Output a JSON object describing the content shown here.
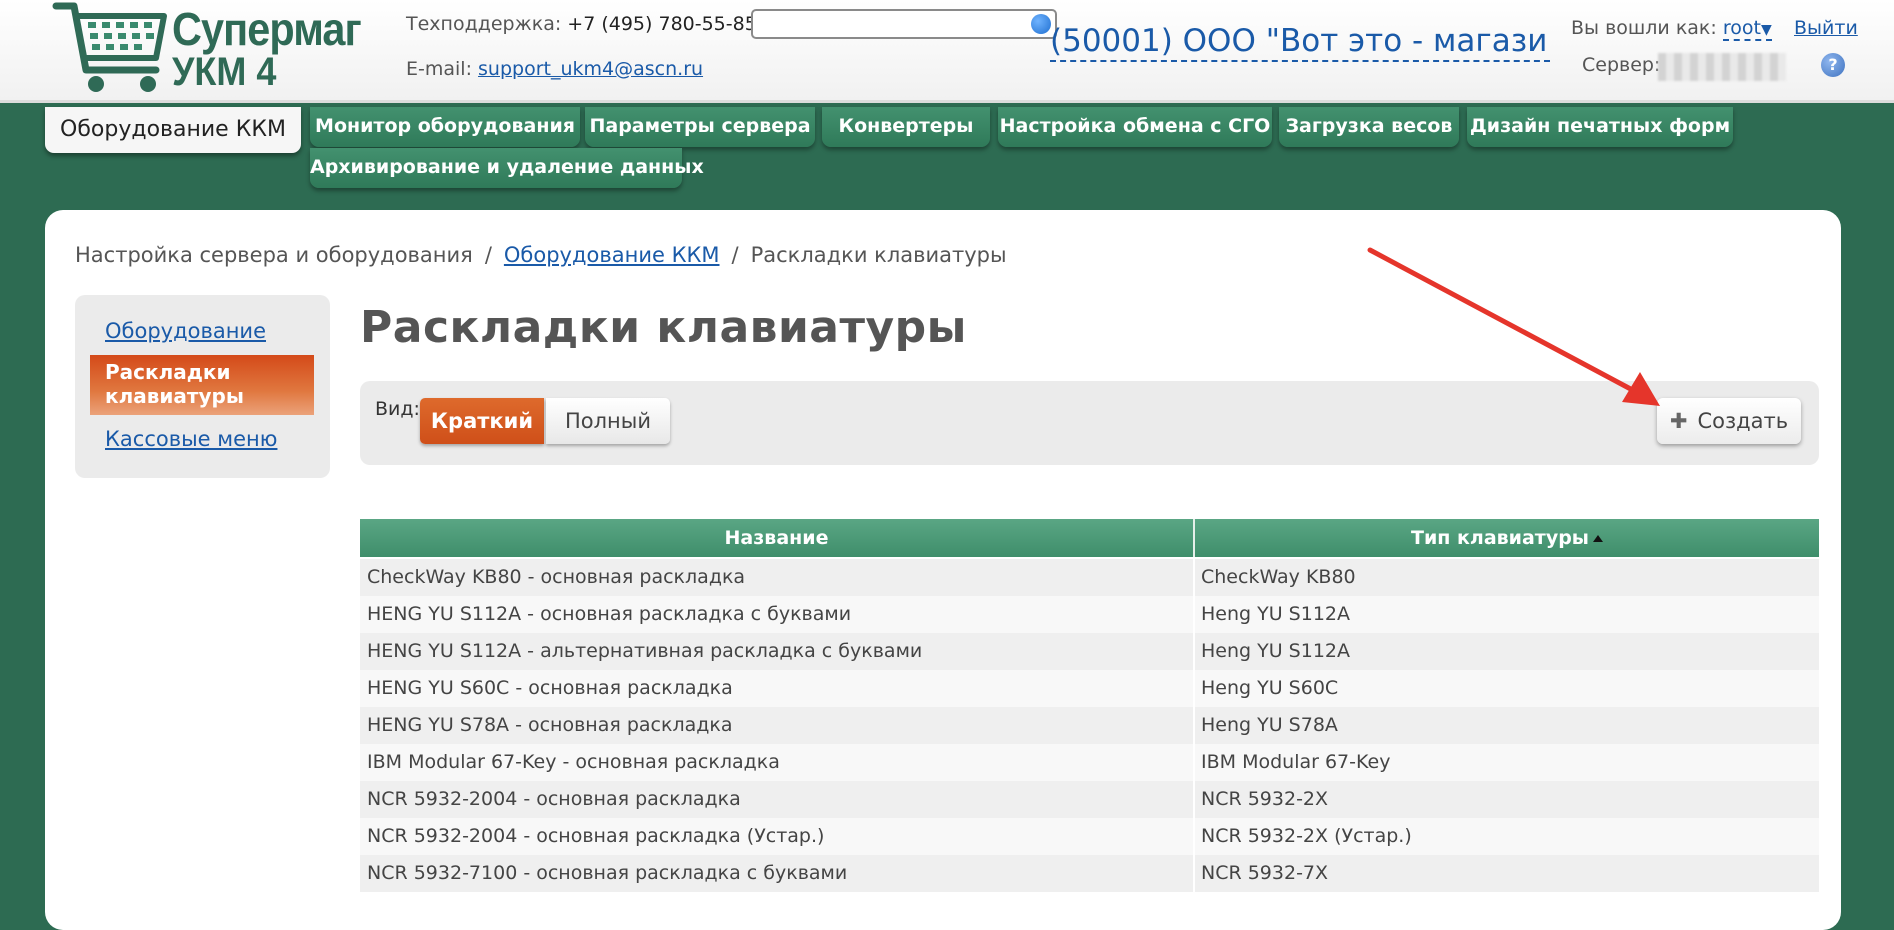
{
  "header": {
    "logo": {
      "line1": "Супермаг",
      "line2": "УКМ 4"
    },
    "support_label": "Техподдержка:",
    "support_phone": "+7 (495) 780-55-85",
    "email_label": "E-mail:",
    "email": "support_ukm4@ascn.ru",
    "search": {
      "value": "",
      "placeholder": ""
    },
    "org_name": "(50001) ООО \"Вот это - магазин\" (...",
    "logged_in_label": "Вы вошли как:",
    "user": "root",
    "logout": "Выйти",
    "server_label": "Сервер:",
    "help": "?"
  },
  "tabs": [
    {
      "label": "Оборудование ККМ",
      "active": true
    },
    {
      "label": "Монитор оборудования"
    },
    {
      "label": "Параметры сервера"
    },
    {
      "label": "Конвертеры"
    },
    {
      "label": "Настройка обмена с СГО"
    },
    {
      "label": "Загрузка весов"
    },
    {
      "label": "Дизайн печатных форм"
    },
    {
      "label": "Архивирование и удаление данных"
    }
  ],
  "breadcrumb": {
    "root": "Настройка сервера и оборудования",
    "link": "Оборудование ККМ",
    "current": "Раскладки клавиатуры",
    "separator": "/"
  },
  "sidebar": {
    "items": [
      {
        "label": "Оборудование"
      },
      {
        "label": "Раскладки клавиатуры",
        "active": true
      },
      {
        "label": "Кассовые меню"
      }
    ]
  },
  "page": {
    "title": "Раскладки клавиатуры",
    "view_label": "Вид:",
    "view_short": "Краткий",
    "view_full": "Полный",
    "create": "Создать"
  },
  "table": {
    "columns": [
      "Название",
      "Тип клавиатуры"
    ],
    "sorted_column": 1,
    "rows": [
      [
        "CheckWay KB80 - основная раскладка",
        "CheckWay KB80"
      ],
      [
        "HENG YU S112A - основная раскладка с буквами",
        "Heng YU S112A"
      ],
      [
        "HENG YU S112A - альтернативная раскладка с буквами",
        "Heng YU S112A"
      ],
      [
        "HENG YU S60C - основная раскладка",
        "Heng YU S60C"
      ],
      [
        "HENG YU S78A - основная раскладка",
        "Heng YU S78A"
      ],
      [
        "IBM Modular 67-Key - основная раскладка",
        "IBM Modular 67-Key"
      ],
      [
        "NCR 5932-2004 - основная раскладка",
        "NCR 5932-2X"
      ],
      [
        "NCR 5932-2004 - основная раскладка (Устар.)",
        "NCR 5932-2X (Устар.)"
      ],
      [
        "NCR 5932-7100 - основная раскладка с буквами",
        "NCR 5932-7X"
      ]
    ]
  },
  "colors": {
    "brand_green": "#2d6b52",
    "accent_orange": "#d95a22",
    "link_blue": "#1a5aa8",
    "arrow_red": "#e5352b"
  }
}
